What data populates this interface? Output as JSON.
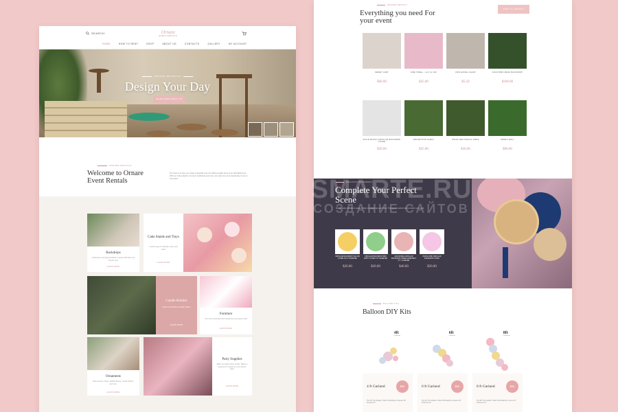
{
  "left": {
    "header": {
      "search_label": "SEARCH",
      "logo_text": "Ornare",
      "logo_sub": "EVENT RENTALS"
    },
    "nav": [
      "HOME",
      "HOW TO RENT",
      "SHOP",
      "ABOUT US",
      "CONTACTS",
      "GALLERY",
      "MY ACCOUNT"
    ],
    "hero": {
      "tagline": "ORNARE BRANDING",
      "title": "Design Your Day",
      "cta": "LEARN MORE ABOUT US"
    },
    "welcome": {
      "kicker": "ORNARE RENTALS",
      "title": "Welcome to Ornare Event Rentals",
      "body": "Our hope is to help you create a beautiful event by offering quality items at an affordable price. With our wide selection of props, backdrops and more, we make sure your special day is one to remember."
    },
    "tiles": {
      "backdrops": {
        "title": "Backdrops",
        "desc": "Looking for a stunning backdrop or photo wall? Find your favorite one!",
        "more": "LEARN MORE"
      },
      "cakestands": {
        "title": "Cake Stands and Trays",
        "desc": "A wide range of materials, colors and styles",
        "more": "LEARN MORE"
      },
      "candles": {
        "title": "Candle Holders",
        "desc": "Set the mood with our candle holders",
        "more": "LEARN MORE"
      },
      "furniture": {
        "title": "Furniture",
        "desc": "The most memorable and complement your party rental",
        "more": "LEARN MORE"
      },
      "ornaments": {
        "title": "Ornaments",
        "desc": "Table accents, vases, artificial flowers, candle holders, and more.",
        "more": "LEARN MORE"
      },
      "party": {
        "title": "Party Supplies",
        "desc": "Match our paper flower rentals. Makes a gorgeous or hostess for your dessert table",
        "more": "LEARN MORE"
      }
    }
  },
  "right": {
    "kicker": "ORNARE RENTALS",
    "title": "Everything you need For your event",
    "shop_btn": "SHOP ALL RENTALS",
    "products": [
      {
        "name": "SWEET CART",
        "price": "$60.00",
        "color": "#dcd4cc"
      },
      {
        "name": "SIDE TABLE – rent for 24h",
        "price": "$25.00",
        "color": "#e8b9c9"
      },
      {
        "name": "KIDS EIFFEL CHAIR",
        "price": "$5.50",
        "color": "#bfb7ad"
      },
      {
        "name": "GOLD BIRD MESH BACKDROP",
        "price": "$100.00",
        "color": "#35512b"
      },
      {
        "name": "SOLID WHITE CIRCULAR BACKDROP COVER",
        "price": "$30.00",
        "color": "#e4e4e4"
      },
      {
        "name": "DECORATIVE SHELF",
        "price": "$25.00",
        "color": "#4a6a33"
      },
      {
        "name": "WOOD RECTANGLE TABLE",
        "price": "$30.00",
        "color": "#3f5a2d"
      },
      {
        "name": "GREEN WALL",
        "price": "$90.00",
        "color": "#3a6a2c"
      }
    ],
    "scene": {
      "kicker": "BEAUTIFUL BACKDROPS",
      "title": "Complete Your Perfect Scene",
      "body": "Shades going definitive to space. It helps to incorporate your theme. They are the perfect way to smarten your event.",
      "items": [
        {
          "name": "CIRCULAR BACKDROP YELLOW COVER 6,5 FT DIAMETER",
          "price": "$20.00",
          "color": "#f5cf63"
        },
        {
          "name": "CIRCULAR BACKDROP DINO PARTY COVER 6 FT DIAMETER",
          "price": "$20.00",
          "color": "#8fcf8b"
        },
        {
          "name": "ADJUSTABLE CIRCULAR BACKDROP FRAME DIAMETER 6 FT / 1.8 METER",
          "price": "$40.00",
          "color": "#e9b4b4"
        },
        {
          "name": "PASTEL PINK CIRCULAR BACKDROP COVER",
          "price": "$20.00",
          "color": "#f5c6e5"
        }
      ]
    },
    "balloons": {
      "kicker": "BALLOON KITS",
      "title": "Balloon DIY Kits",
      "kits": [
        {
          "size": "4ft",
          "sub": "30 balloons",
          "label": "4 ft Garland",
          "price": "$50",
          "incl": "The DIY Kit includes: Total of 30 balloons 5 pieces 18\" 20 pieces 5\""
        },
        {
          "size": "6ft",
          "sub": "50 balloons",
          "label": "6 ft Garland",
          "price": "$60",
          "incl": "The DIY Kit includes: Total of 50 balloons 2 pieces 18\" 30 pieces 11\""
        },
        {
          "size": "8ft",
          "sub": "100 balloons",
          "label": "8 ft Garland",
          "price": "$65",
          "incl": "The DIY Kit includes: Total of 100 balloons 1 piece 24\" 30 pieces 11\""
        }
      ]
    }
  },
  "watermark": {
    "line1": "SMARTE.RU",
    "line2": "СОЗДАНИЕ САЙТОВ"
  }
}
